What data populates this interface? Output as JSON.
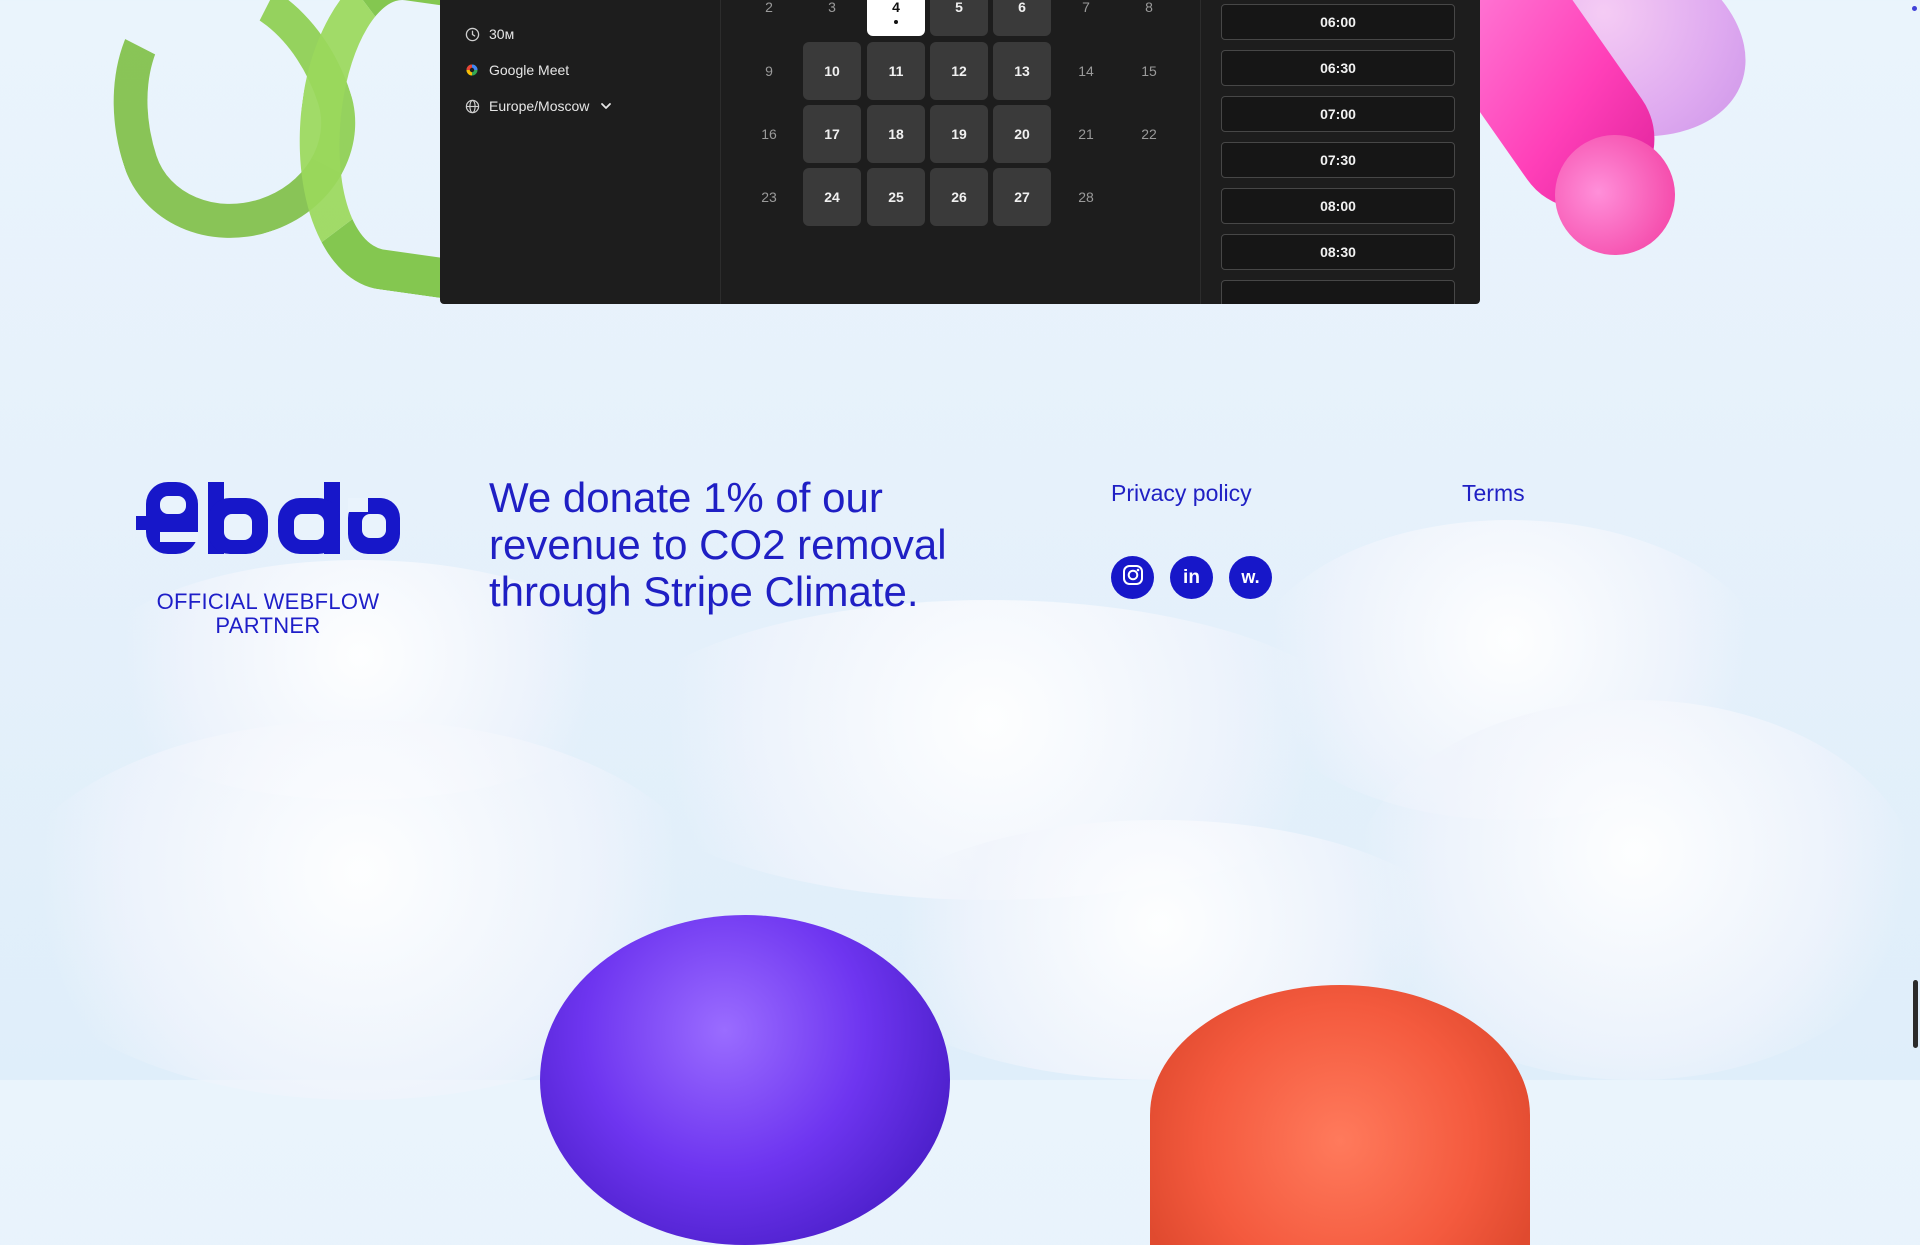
{
  "scheduler": {
    "duration": "30м",
    "meeting_app": "Google Meet",
    "timezone": "Europe/Moscow",
    "calendar": {
      "rows": [
        [
          {
            "d": "2",
            "state": "muted"
          },
          {
            "d": "3",
            "state": "muted"
          },
          {
            "d": "4",
            "state": "selected"
          },
          {
            "d": "5",
            "state": "available"
          },
          {
            "d": "6",
            "state": "available"
          },
          {
            "d": "7",
            "state": "muted"
          },
          {
            "d": "8",
            "state": "muted"
          }
        ],
        [
          {
            "d": "9",
            "state": "muted"
          },
          {
            "d": "10",
            "state": "available"
          },
          {
            "d": "11",
            "state": "available"
          },
          {
            "d": "12",
            "state": "available"
          },
          {
            "d": "13",
            "state": "available"
          },
          {
            "d": "14",
            "state": "muted"
          },
          {
            "d": "15",
            "state": "muted"
          }
        ],
        [
          {
            "d": "16",
            "state": "muted"
          },
          {
            "d": "17",
            "state": "available"
          },
          {
            "d": "18",
            "state": "available"
          },
          {
            "d": "19",
            "state": "available"
          },
          {
            "d": "20",
            "state": "available"
          },
          {
            "d": "21",
            "state": "muted"
          },
          {
            "d": "22",
            "state": "muted"
          }
        ],
        [
          {
            "d": "23",
            "state": "muted"
          },
          {
            "d": "24",
            "state": "available"
          },
          {
            "d": "25",
            "state": "available"
          },
          {
            "d": "26",
            "state": "available"
          },
          {
            "d": "27",
            "state": "available"
          },
          {
            "d": "28",
            "state": "muted"
          }
        ]
      ]
    },
    "time_slots": [
      "06:00",
      "06:30",
      "07:00",
      "07:30",
      "08:00",
      "08:30"
    ]
  },
  "footer": {
    "logo_text": "ebda",
    "partner_label": "OFFICIAL WEBFLOW PARTNER",
    "donation_text": "We donate 1% of our revenue to CO2 removal through Stripe Climate.",
    "links": {
      "privacy": "Privacy policy",
      "terms": "Terms"
    },
    "social": [
      {
        "name": "instagram-icon",
        "glyph": ""
      },
      {
        "name": "linkedin-icon",
        "glyph": "in"
      },
      {
        "name": "webflow-icon",
        "glyph": "w."
      }
    ]
  },
  "colors": {
    "brand_blue": "#1717c9",
    "widget_bg": "#1d1d1d"
  }
}
